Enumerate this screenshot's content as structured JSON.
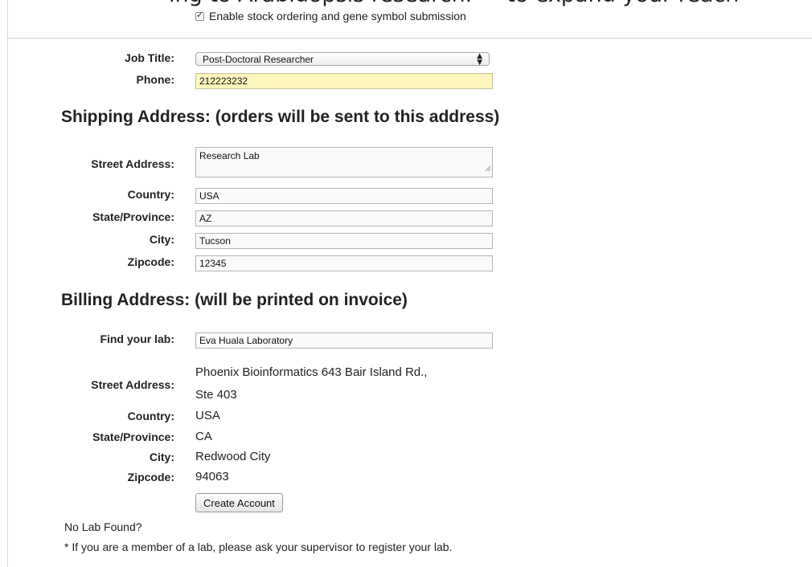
{
  "banner": {
    "part1": "ing to Arabidopsis research.",
    "part2": "to expand your reach"
  },
  "stock_ordering": {
    "checked": true,
    "label": "Enable stock ordering and gene symbol submission"
  },
  "job_title": {
    "label": "Job Title:",
    "value": "Post-Doctoral Researcher"
  },
  "phone": {
    "label": "Phone:",
    "value": "212223232"
  },
  "shipping": {
    "heading": "Shipping Address: (orders will be sent to this address)",
    "street": {
      "label": "Street Address:",
      "value": "Research Lab"
    },
    "country": {
      "label": "Country:",
      "value": "USA"
    },
    "state": {
      "label": "State/Province:",
      "value": "AZ"
    },
    "city": {
      "label": "City:",
      "value": "Tucson"
    },
    "zipcode": {
      "label": "Zipcode:",
      "value": "12345"
    }
  },
  "billing": {
    "heading": "Billing Address: (will be printed on invoice)",
    "find_lab": {
      "label": "Find your lab:",
      "value": "Eva Huala Laboratory"
    },
    "street": {
      "label": "Street Address:",
      "line1": "Phoenix Bioinformatics 643 Bair Island Rd.,",
      "line2": "Ste 403"
    },
    "country": {
      "label": "Country:",
      "value": "USA"
    },
    "state": {
      "label": "State/Province:",
      "value": "CA"
    },
    "city": {
      "label": "City:",
      "value": "Redwood City"
    },
    "zipcode": {
      "label": "Zipcode:",
      "value": "94063"
    }
  },
  "create_account_label": "Create Account",
  "no_lab": "No Lab Found?",
  "footnote": "* If you are a member of a lab, please ask your supervisor to register your lab."
}
